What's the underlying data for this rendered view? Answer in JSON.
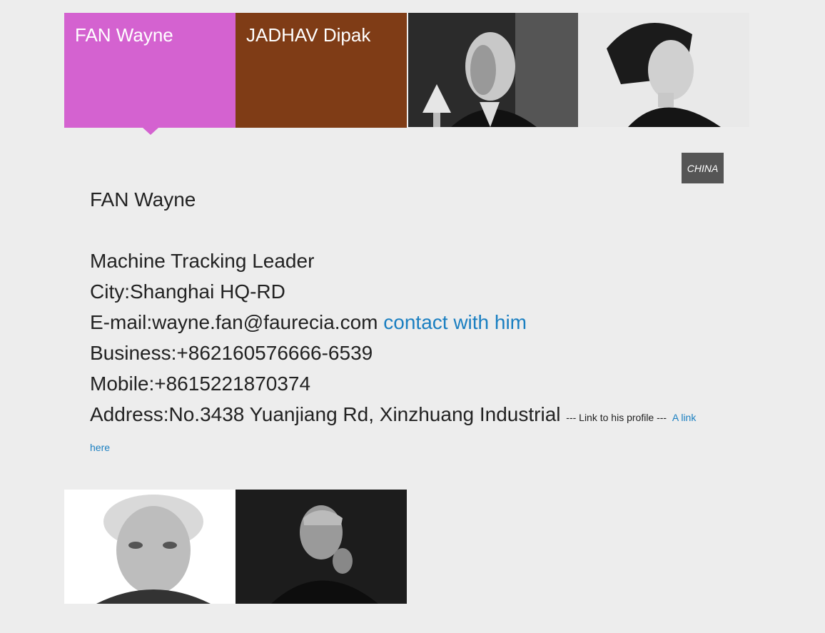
{
  "tiles": [
    {
      "name": "FAN Wayne",
      "color": "#d462d0",
      "active": true
    },
    {
      "name": "JADHAV Dipak",
      "color": "#7f3c16"
    }
  ],
  "photo_tiles": [
    {
      "icon": "portrait-man-lamp-photo"
    },
    {
      "icon": "portrait-woman-photo"
    },
    {
      "icon": "portrait-elderly-man-photo"
    },
    {
      "icon": "portrait-man-hand-chin-photo"
    }
  ],
  "badge": {
    "label": "CHINA"
  },
  "profile": {
    "name": "FAN Wayne",
    "title": "Machine Tracking Leader",
    "city": "City:Shanghai HQ-RD",
    "email": "E-mail:wayne.fan@faurecia.com",
    "contact_link": "contact with him",
    "business": "Business:+862160576666-6539",
    "mobile": "Mobile:+8615221870374",
    "address": "Address:No.3438 Yuanjiang Rd, Xinzhuang Industrial",
    "profile_note": "--- Link to his profile  ---",
    "profile_link_1": "A link",
    "profile_link_2": "here"
  },
  "colors": {
    "accent_link": "#1a7fc1",
    "badge_bg": "#555555",
    "page_bg": "#ededed"
  }
}
